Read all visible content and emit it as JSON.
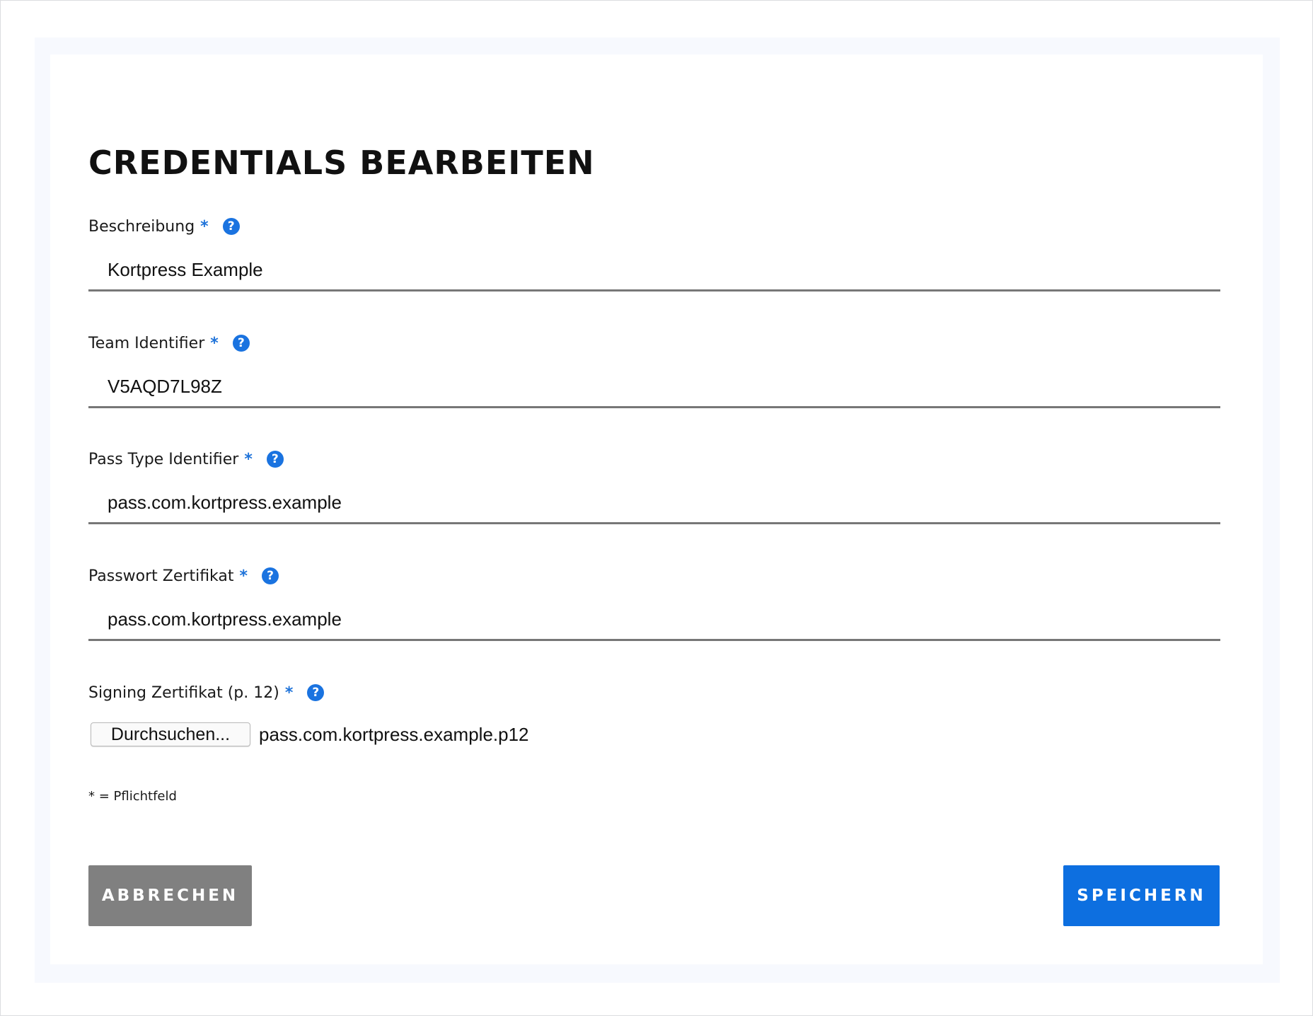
{
  "form": {
    "title": "CREDENTIALS BEARBEITEN",
    "required_marker": "*",
    "help_symbol": "?",
    "fields": [
      {
        "label": "Beschreibung",
        "value": "Kortpress Example"
      },
      {
        "label": "Team Identifier",
        "value": "V5AQD7L98Z"
      },
      {
        "label": "Pass Type Identifier",
        "value": "pass.com.kortpress.example"
      },
      {
        "label": "Passwort Zertifikat",
        "value": "pass.com.kortpress.example"
      }
    ],
    "file_field": {
      "label": "Signing Zertifikat (p. 12)",
      "button_label": "Durchsuchen...",
      "file_name": "pass.com.kortpress.example.p12"
    },
    "note": "* = Pflichtfeld",
    "cancel_label": "ABBRECHEN",
    "save_label": "SPEICHERN"
  },
  "colors": {
    "accent": "#0d6fe0",
    "help_icon": "#1a73e0",
    "cancel_button": "#808080",
    "underline": "#777777",
    "frame_background": "#f7f9fe"
  },
  "icons": {
    "help": "question-circle-icon"
  }
}
